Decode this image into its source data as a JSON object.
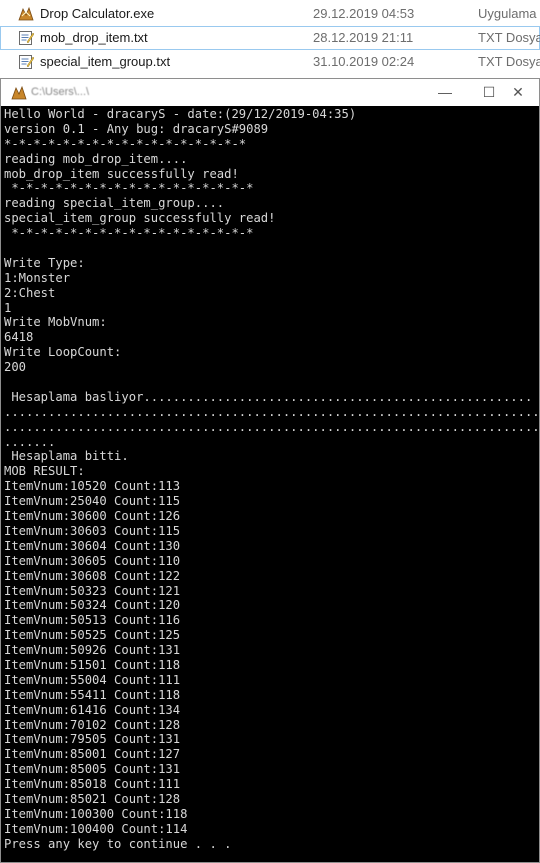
{
  "explorer": {
    "files": [
      {
        "icon": "app-exe-icon",
        "name": "Drop Calculator.exe",
        "date": "29.12.2019 04:53",
        "type": "Uygulama"
      },
      {
        "icon": "text-file-icon",
        "name": "mob_drop_item.txt",
        "date": "28.12.2019 21:11",
        "type": "TXT Dosya"
      },
      {
        "icon": "text-file-icon",
        "name": "special_item_group.txt",
        "date": "31.10.2019 02:24",
        "type": "TXT Dosya"
      }
    ]
  },
  "console_window": {
    "title": "C:\\Users\\...\\",
    "minimize": "—",
    "maximize": "☐",
    "close": "✕",
    "lines": [
      "Hello World - dracaryS - date:(29/12/2019-04:35)",
      "version 0.1 - Any bug: dracaryS#9089",
      "*-*-*-*-*-*-*-*-*-*-*-*-*-*-*-*-*",
      "reading mob_drop_item....",
      "mob_drop_item successfully read!",
      " *-*-*-*-*-*-*-*-*-*-*-*-*-*-*-*-*",
      "reading special_item_group....",
      "special_item_group successfully read!",
      " *-*-*-*-*-*-*-*-*-*-*-*-*-*-*-*-*",
      "",
      "Write Type:",
      "1:Monster",
      "2:Chest",
      "1",
      "Write MobVnum:",
      "6418",
      "Write LoopCount:",
      "200",
      "",
      " Hesaplama basliyor.....................................................",
      "..........................................................................",
      "..........................................................................",
      ".......",
      " Hesaplama bitti.",
      "MOB RESULT:",
      "ItemVnum:10520 Count:113",
      "ItemVnum:25040 Count:115",
      "ItemVnum:30600 Count:126",
      "ItemVnum:30603 Count:115",
      "ItemVnum:30604 Count:130",
      "ItemVnum:30605 Count:110",
      "ItemVnum:30608 Count:122",
      "ItemVnum:50323 Count:121",
      "ItemVnum:50324 Count:120",
      "ItemVnum:50513 Count:116",
      "ItemVnum:50525 Count:125",
      "ItemVnum:50926 Count:131",
      "ItemVnum:51501 Count:118",
      "ItemVnum:55004 Count:111",
      "ItemVnum:55411 Count:118",
      "ItemVnum:61416 Count:134",
      "ItemVnum:70102 Count:128",
      "ItemVnum:79505 Count:131",
      "ItemVnum:85001 Count:127",
      "ItemVnum:85005 Count:131",
      "ItemVnum:85018 Count:111",
      "ItemVnum:85021 Count:128",
      "ItemVnum:100300 Count:118",
      "ItemVnum:100400 Count:114",
      "Press any key to continue . . ."
    ]
  },
  "colors": {
    "console_bg": "#000000",
    "console_text": "#d8d8d8",
    "selection_border": "#99c9ef"
  }
}
